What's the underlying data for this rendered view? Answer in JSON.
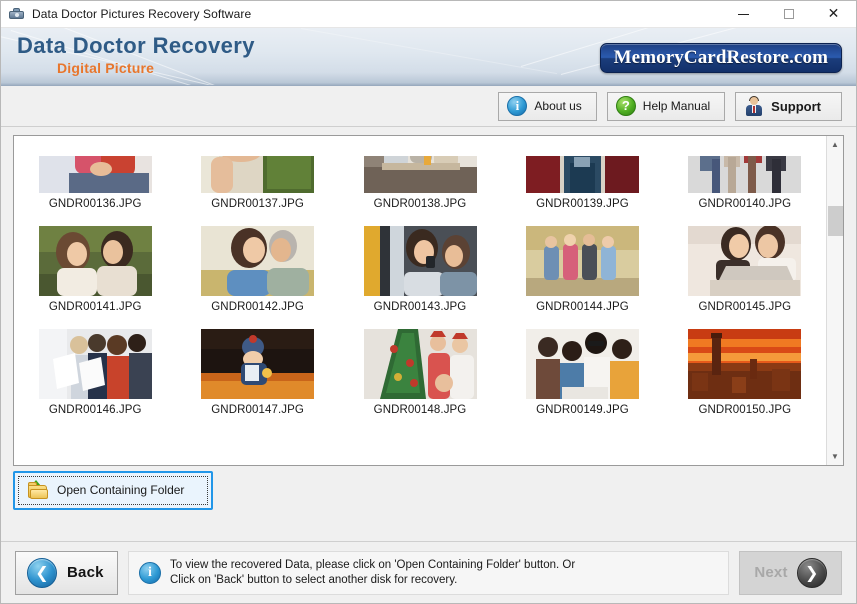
{
  "window": {
    "title": "Data Doctor Pictures Recovery Software",
    "app_icon": "camera-icon",
    "controls": {
      "minimize": "minimize-icon",
      "maximize": "maximize-icon",
      "close": "close-icon"
    }
  },
  "header": {
    "brand_main": "Data Doctor Recovery",
    "brand_sub": "Digital Picture",
    "logo_text": "MemoryCardRestore.com",
    "brand_main_color": "#2f5b86",
    "brand_sub_color": "#e8762c",
    "logo_bg_color": "#1d3f82"
  },
  "toolbar": {
    "buttons": [
      {
        "label": "About us",
        "icon": "info-icon",
        "glyph": "i",
        "color": "#2e9ad4"
      },
      {
        "label": "Help Manual",
        "icon": "question-icon",
        "glyph": "?",
        "color": "#4fae22"
      },
      {
        "label": "Support",
        "icon": "support-person-icon",
        "glyph": "",
        "color": "#3b5c8f"
      }
    ]
  },
  "thumbnails": {
    "rows": [
      [
        {
          "filename": "GNDR00136.JPG"
        },
        {
          "filename": "GNDR00137.JPG"
        },
        {
          "filename": "GNDR00138.JPG"
        },
        {
          "filename": "GNDR00139.JPG"
        },
        {
          "filename": "GNDR00140.JPG"
        }
      ],
      [
        {
          "filename": "GNDR00141.JPG"
        },
        {
          "filename": "GNDR00142.JPG"
        },
        {
          "filename": "GNDR00143.JPG"
        },
        {
          "filename": "GNDR00144.JPG"
        },
        {
          "filename": "GNDR00145.JPG"
        }
      ],
      [
        {
          "filename": "GNDR00146.JPG"
        },
        {
          "filename": "GNDR00147.JPG"
        },
        {
          "filename": "GNDR00148.JPG"
        },
        {
          "filename": "GNDR00149.JPG"
        },
        {
          "filename": "GNDR00150.JPG"
        }
      ]
    ],
    "scrollbar": {
      "up": "chevron-up-icon",
      "down": "chevron-down-icon",
      "thumb_position_pct": 20
    }
  },
  "action_bar": {
    "open_folder_label": "Open Containing Folder",
    "open_folder_icon": "folder-upload-icon",
    "focused": true,
    "focus_color": "#2196e8"
  },
  "footer": {
    "back_label": "Back",
    "back_icon": "chevron-left-circle-icon",
    "info_icon": "info-icon",
    "info_line1": "To view the recovered Data, please click on 'Open Containing Folder' button. Or",
    "info_line2": "Click on 'Back' button to select another disk for recovery.",
    "next_label": "Next",
    "next_icon": "chevron-right-circle-icon",
    "next_disabled": true
  }
}
